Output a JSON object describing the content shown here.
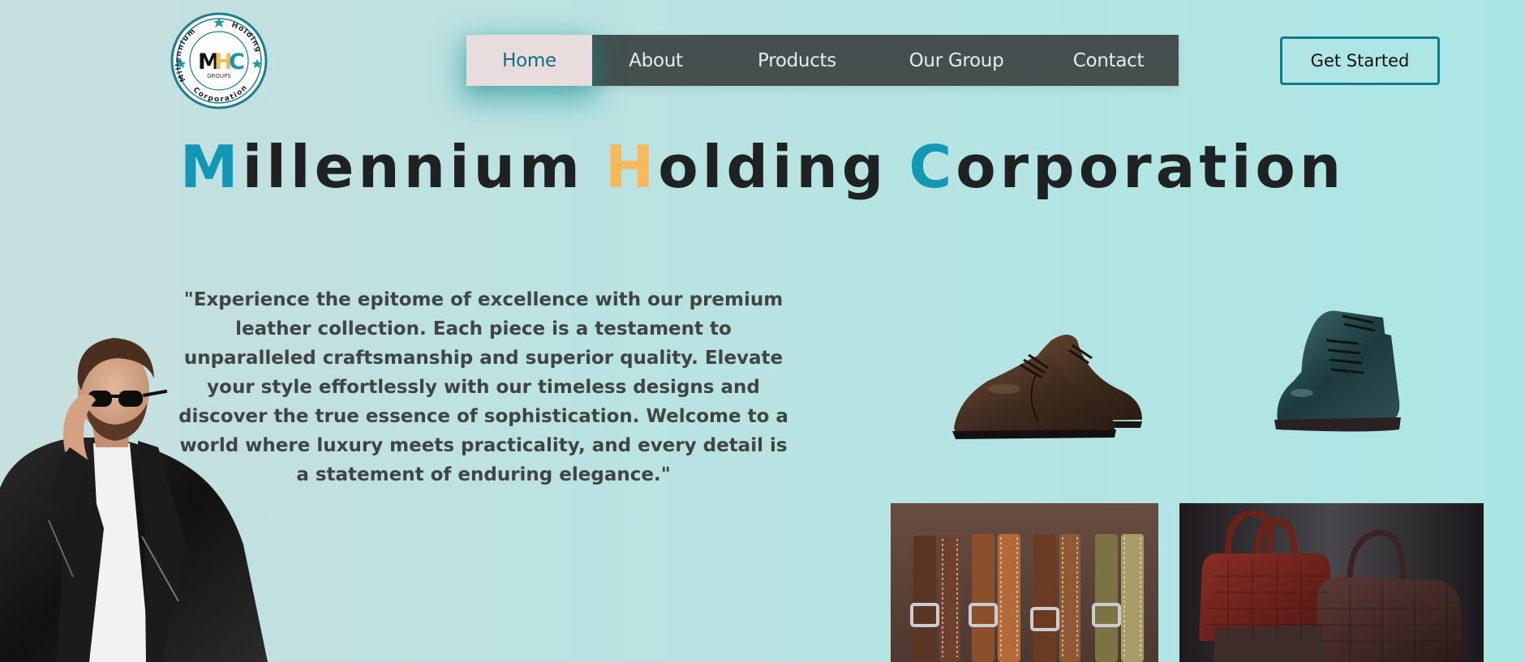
{
  "logo": {
    "ring_text_left": "Millennium",
    "ring_text_right": "Holding",
    "ring_text_bottom": "Corporation",
    "mark_m": "M",
    "mark_h": "H",
    "mark_c": "C",
    "sub": "GROUPS"
  },
  "nav": {
    "items": [
      {
        "label": "Home"
      },
      {
        "label": "About"
      },
      {
        "label": "Products"
      },
      {
        "label": "Our Group"
      },
      {
        "label": "Contact"
      }
    ]
  },
  "cta": {
    "label": "Get Started"
  },
  "title": {
    "w1_initial": "M",
    "w1_rest": "illennium",
    "w2_initial": "H",
    "w2_rest": "olding",
    "w3_initial": "C",
    "w3_rest": "orporation"
  },
  "quote": "\"Experience the epitome of excellence with our premium leather collection. Each piece is a testament to unparalleled craftsmanship and superior quality. Elevate your style effortlessly with our timeless designs and discover the true essence of sophistication. Welcome to a world where luxury meets practicality, and every detail is a statement of enduring elegance.\"",
  "colors": {
    "accent_teal": "#1497b4",
    "accent_gold": "#f7b95a",
    "nav_bg": "#454f4d",
    "nav_active_bg": "#e9dcdc",
    "cta_border": "#137a8c"
  },
  "images": [
    {
      "icon": "model-leather-jacket-icon"
    },
    {
      "icon": "brown-oxford-shoes-icon"
    },
    {
      "icon": "green-leather-boots-icon"
    },
    {
      "icon": "leather-watch-straps-icon"
    },
    {
      "icon": "leather-bags-icon"
    }
  ]
}
